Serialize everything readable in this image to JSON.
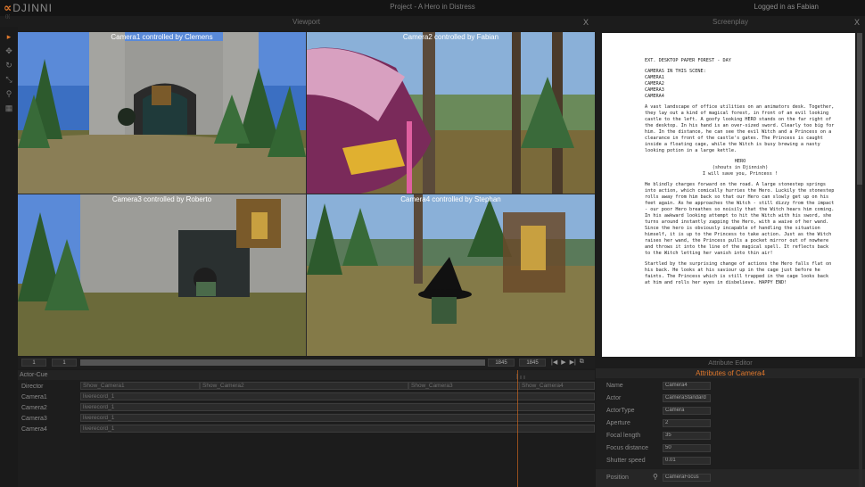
{
  "app": {
    "logo_mark": "∝",
    "logo_word": "DJINNI",
    "logo_sub": "(((",
    "project_title": "Project - A Hero in Distress",
    "user": "Logged in as Fabian"
  },
  "toolbar": {
    "tools": [
      {
        "icon": "pointer-icon",
        "glyph": "▸"
      },
      {
        "icon": "move-icon",
        "glyph": "✥"
      },
      {
        "icon": "rotate-icon",
        "glyph": "↻"
      },
      {
        "icon": "link-icon",
        "glyph": "⤡"
      },
      {
        "icon": "light-icon",
        "glyph": "⚲"
      },
      {
        "icon": "grid-icon",
        "glyph": "▦"
      }
    ]
  },
  "viewport": {
    "title": "Viewport",
    "close": "X",
    "cameras": [
      {
        "label": "Camera1 controlled by Clemens"
      },
      {
        "label": "Camera2 controlled by Fabian"
      },
      {
        "label": "Camera3 controlled by Roberto"
      },
      {
        "label": "Camera4 controlled by Stephan"
      }
    ]
  },
  "screenplay": {
    "title": "Screenplay",
    "close": "X",
    "scene_heading": "EXT. DESKTOP PAPER FOREST - DAY",
    "cameras_heading": "CAMERAS IN THIS SCENE:",
    "camera_list": [
      "CAMERA1",
      "CAMERA2",
      "CAMERA3",
      "CAMERA4"
    ],
    "para1": "A vast landscape of office utilities on an animators desk. Together, they lay out a kind of magical forest, in front of an evil looking castle to the left. A goofy looking HERO stands on the far right of the desktop. In his hand is an over-sized sword. Clearly too big for him. In the distance, he can see the evil Witch and a Princess on a clearance in front of the castle's gates. The Princess is caught inside a floating cage, while the Witch is busy brewing a nasty looking potion in a large kettle.",
    "char_name": "HERO",
    "paren": "(shouts in Djinnish)",
    "dialogue": "I will save you, Princess !",
    "para2": "He blindly charges forward on the road. A large stonestep springs into action, which comically hurries the Hero. Luckily the stonestep rolls away from him back so that our Hero can slowly get up on his feet again. As he approaches the Witch - still dizzy from the impact - our poor Hero breathes so noisily that the Witch hears him coming. In his awkward looking attempt to hit the Witch with his sword, she turns around instantly zapping the Hero, with a waive of her wand. Since the hero is obviously incapable of handling the situation himself, it is up to the Princess to take action. Just as the Witch raises her wand, the Princess pulls a pocket mirror out of nowhere and throws it into the line of the magical spell. It reflects back to the Witch letting her vanish into thin air!",
    "para3": "Startled by the surprising change of actions the Hero falls flat on his back. He looks at his saviour up in the cage just before he faints. The Princess which is still trapped in the cage looks back at him and rolls her eyes in disbelieve. HAPPY END!"
  },
  "timecontrol": {
    "start": "1",
    "step": "1",
    "current": "1845",
    "end": "1845",
    "progress": 1.0,
    "buttons": [
      {
        "icon": "skip-back-icon",
        "glyph": "|◀"
      },
      {
        "icon": "play-icon",
        "glyph": "▶"
      },
      {
        "icon": "skip-forward-icon",
        "glyph": "▶|"
      },
      {
        "icon": "loop-icon",
        "glyph": "⧉"
      }
    ]
  },
  "timeline": {
    "header": "Actor-Cue",
    "tracks": [
      {
        "label": "Director",
        "clips": [
          {
            "text": "Show_Camera1",
            "start": 0.0,
            "end": 0.232
          },
          {
            "text": "Show_Camera2",
            "start": 0.232,
            "end": 0.637
          },
          {
            "text": "Show_Camera3",
            "start": 0.637,
            "end": 0.853
          },
          {
            "text": "Show_Camera4",
            "start": 0.853,
            "end": 1.0
          }
        ]
      },
      {
        "label": "Camera1",
        "clips": [
          {
            "text": "liverecord_1",
            "start": 0.0,
            "end": 1.0
          }
        ]
      },
      {
        "label": "Camera2",
        "clips": [
          {
            "text": "liverecord_1",
            "start": 0.0,
            "end": 1.0
          }
        ]
      },
      {
        "label": "Camera3",
        "clips": [
          {
            "text": "liverecord_1",
            "start": 0.0,
            "end": 1.0
          }
        ]
      },
      {
        "label": "Camera4",
        "clips": [
          {
            "text": "liverecord_1",
            "start": 0.0,
            "end": 1.0
          }
        ]
      }
    ]
  },
  "attributes": {
    "title": "Attribute Editor",
    "subtitle": "Attributes of Camera4",
    "rows": [
      {
        "name": "Name",
        "value": "Camera4"
      },
      {
        "name": "Actor",
        "value": "CameraStandard"
      },
      {
        "name": "ActorType",
        "value": "Camera"
      },
      {
        "name": "Aperture",
        "value": "2"
      },
      {
        "name": "Focal length",
        "value": "35"
      },
      {
        "name": "Focus distance",
        "value": "50"
      },
      {
        "name": "Shutter speed",
        "value": "0.01"
      }
    ],
    "position_label": "Position",
    "position_value": "CameraFocus"
  },
  "colors": {
    "accent": "#e0782c",
    "background": "#1c1c1c",
    "panel": "#262626"
  }
}
